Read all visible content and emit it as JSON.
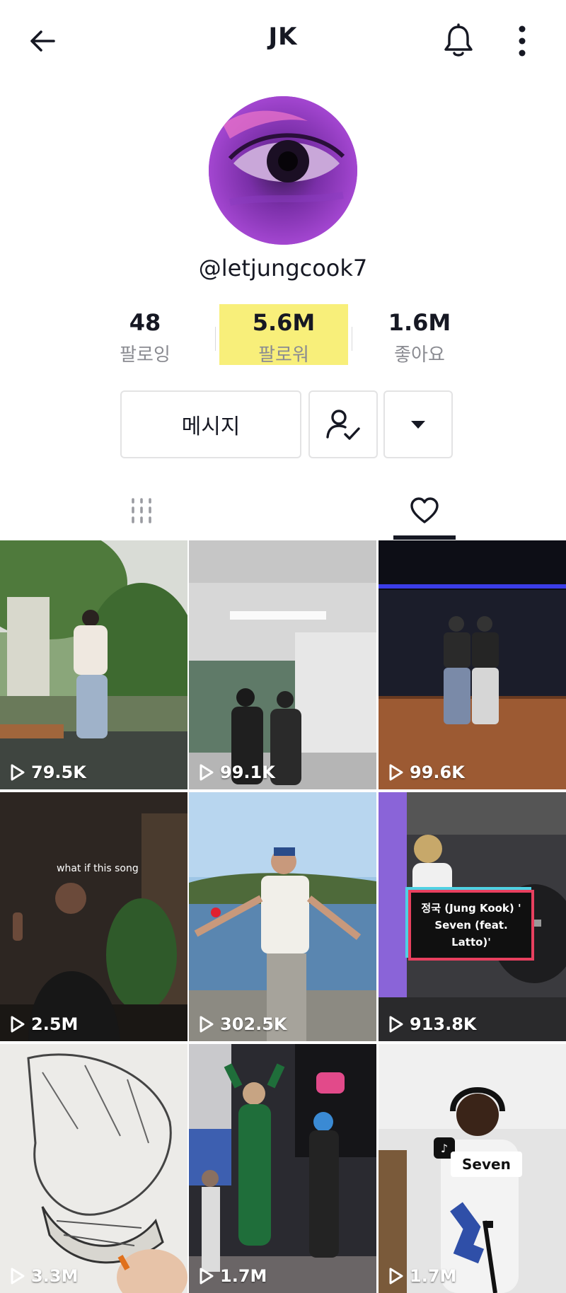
{
  "header": {
    "title": "JK",
    "back_icon": "back-arrow-icon",
    "bell_icon": "bell-icon",
    "more_icon": "more-vertical-icon"
  },
  "profile": {
    "username": "@letjungcook7",
    "avatar": "eye-closeup-avatar"
  },
  "stats": [
    {
      "value": "48",
      "label": "팔로잉"
    },
    {
      "value": "5.6M",
      "label": "팔로워"
    },
    {
      "value": "1.6M",
      "label": "좋아요"
    }
  ],
  "highlight_color": "#f8ef7a",
  "buttons": {
    "message_label": "메시지",
    "friend_icon": "user-check-icon",
    "dropdown_icon": "caret-down-icon"
  },
  "tabs": [
    {
      "icon": "grid-icon",
      "active": false
    },
    {
      "icon": "heart-icon",
      "active": true
    }
  ],
  "videos": [
    {
      "views": "79.5K"
    },
    {
      "views": "99.1K"
    },
    {
      "views": "99.6K"
    },
    {
      "views": "2.5M",
      "caption": "what if this song"
    },
    {
      "views": "302.5K"
    },
    {
      "views": "913.8K",
      "caption": "정국 (Jung Kook) ' Seven (feat. Latto)'"
    },
    {
      "views": "3.3M"
    },
    {
      "views": "1.7M"
    },
    {
      "views": "1.7M",
      "caption": "Seven"
    }
  ]
}
